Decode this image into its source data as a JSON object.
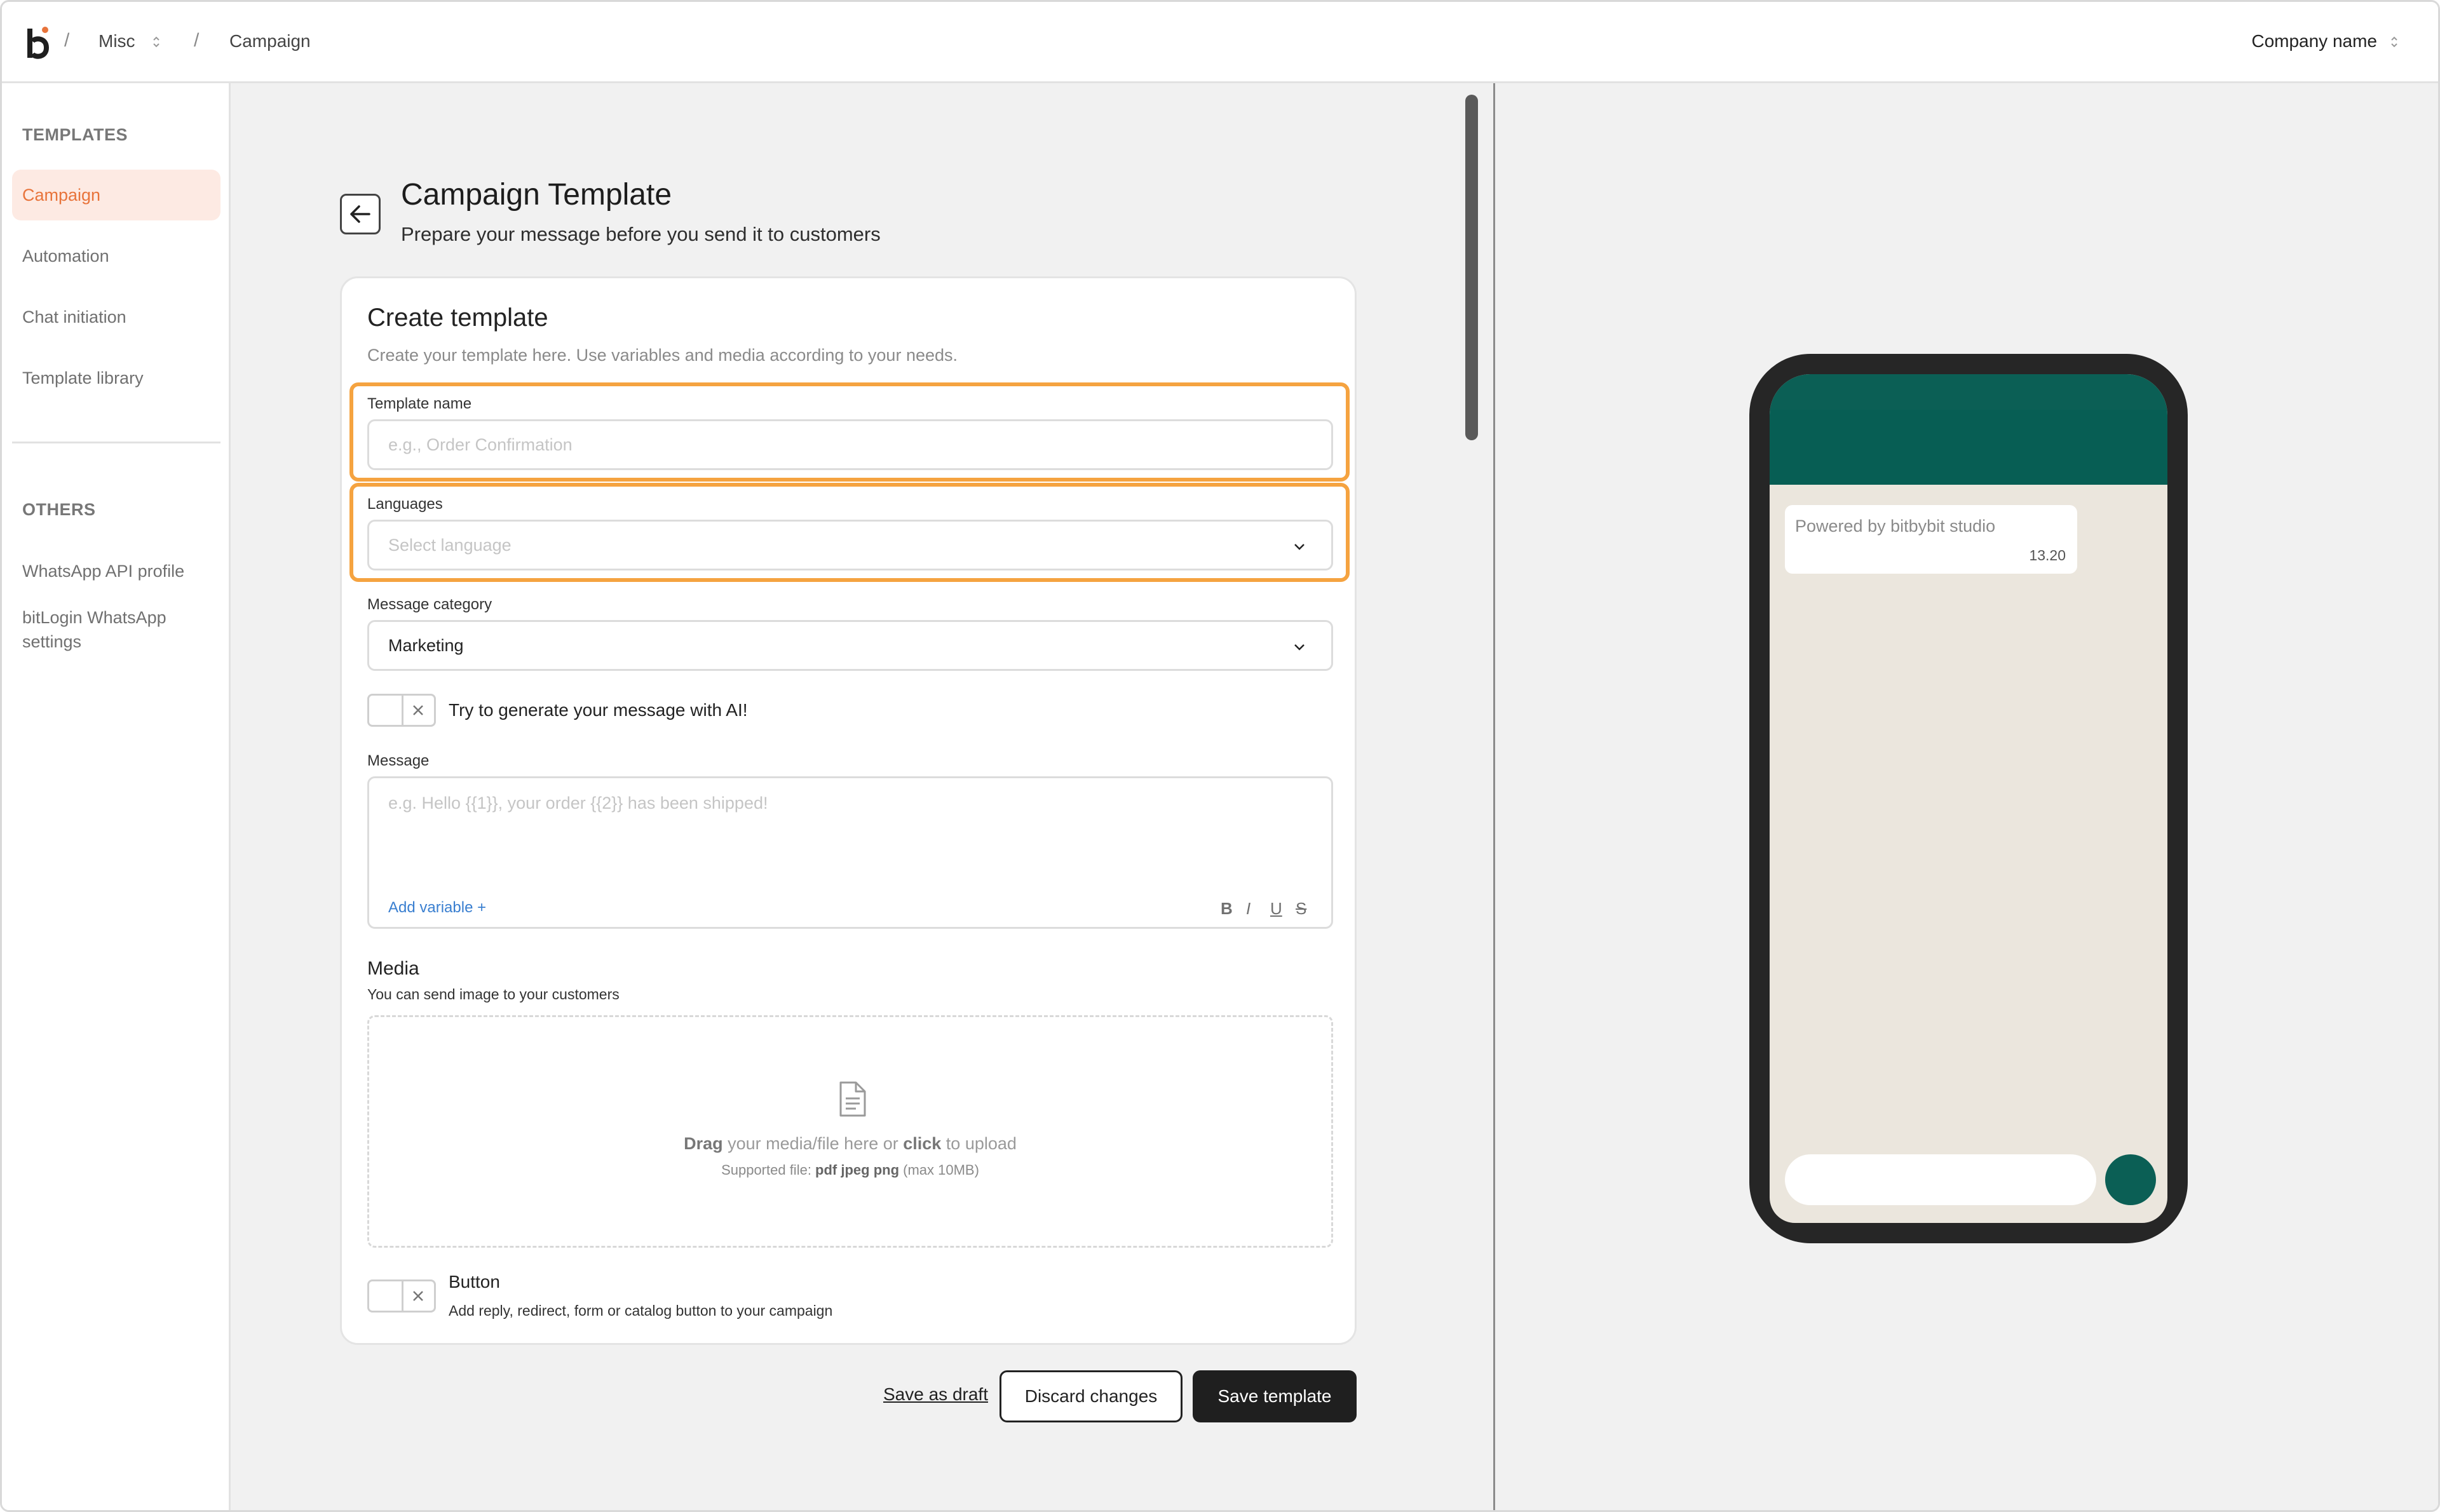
{
  "topbar": {
    "logo_text": "b",
    "breadcrumb": [
      {
        "label": "Misc",
        "has_selector": true
      },
      {
        "label": "Campaign",
        "has_selector": false
      }
    ],
    "company_label": "Company name"
  },
  "sidebar": {
    "sections": [
      {
        "title": "TEMPLATES",
        "items": [
          {
            "label": "Campaign",
            "active": true
          },
          {
            "label": "Automation",
            "active": false
          },
          {
            "label": "Chat initiation",
            "active": false
          },
          {
            "label": "Template library",
            "active": false
          }
        ]
      },
      {
        "title": "OTHERS",
        "items": [
          {
            "label": "WhatsApp API profile",
            "active": false
          },
          {
            "label": "bitLogin WhatsApp settings",
            "active": false
          }
        ]
      }
    ]
  },
  "page": {
    "title": "Campaign Template",
    "subtitle": "Prepare your message before you send it to customers"
  },
  "form": {
    "card_title": "Create template",
    "card_subtitle": "Create your template here. Use variables and media according to your needs.",
    "template_name": {
      "label": "Template name",
      "placeholder": "e.g., Order Confirmation",
      "value": ""
    },
    "languages": {
      "label": "Languages",
      "placeholder": "Select language",
      "value": ""
    },
    "message_category": {
      "label": "Message category",
      "value": "Marketing"
    },
    "ai_toggle": {
      "label": "Try to generate your message with AI!",
      "on": false
    },
    "message": {
      "label": "Message",
      "placeholder": "e.g. Hello {{1}}, your order {{2}} has been shipped!",
      "add_variable": "Add variable +",
      "format_tools": [
        "B",
        "I",
        "U",
        "S"
      ]
    },
    "media": {
      "title": "Media",
      "subtitle": "You can send image to your customers",
      "drop_drag": "Drag",
      "drop_mid": " your media/file here or ",
      "drop_click": "click",
      "drop_end": " to upload",
      "supported_prefix": "Supported file: ",
      "supported_types": "pdf jpeg png",
      "supported_suffix": " (max 10MB)"
    },
    "button_toggle": {
      "label": "Button",
      "description": "Add reply, redirect, form or catalog button to your campaign",
      "on": false
    }
  },
  "actions": {
    "save_draft": "Save as draft",
    "discard": "Discard changes",
    "save": "Save template"
  },
  "preview": {
    "bubble_text": "Powered by bitbybit studio",
    "bubble_time": "13.20"
  },
  "colors": {
    "accent": "#e8743b",
    "accent_bg": "#fdeae3",
    "highlight": "#f5a340",
    "whatsapp_green": "#075e54",
    "link_blue": "#3a7fd0",
    "primary_dark": "#1f1f1f"
  },
  "icons": {
    "back": "arrow-left-icon",
    "select": "chevron-down-icon",
    "toggle_off": "close-icon",
    "upload": "document-icon",
    "breadcrumb_selector": "updown-chevron-icon"
  }
}
